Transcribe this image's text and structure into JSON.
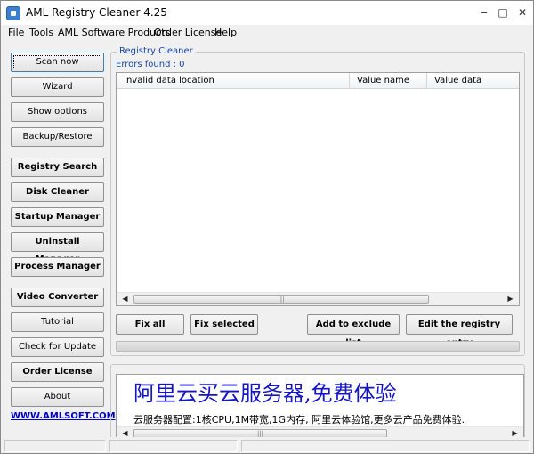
{
  "window": {
    "title": "AML Registry Cleaner 4.25",
    "minimize": "‒",
    "maximize": "□",
    "close": "✕"
  },
  "menu": [
    "File",
    "Tools",
    "AML Software Products",
    "Order License",
    "Help"
  ],
  "sidebar": {
    "scan_now": "Scan now",
    "wizard": "Wizard",
    "show_options": "Show options",
    "backup_restore": "Backup/Restore",
    "registry_search": "Registry Search",
    "disk_cleaner": "Disk Cleaner",
    "startup_manager": "Startup Manager",
    "uninstall_manager": "Uninstall Manager",
    "process_manager": "Process Manager",
    "video_converter": "Video Converter",
    "tutorial": "Tutorial",
    "check_for_update": "Check for Update",
    "order_license": "Order License",
    "about": "About",
    "website": "WWW.AMLSOFT.COM"
  },
  "cleaner": {
    "group_title": "Registry Cleaner",
    "errors_found": "Errors found : 0",
    "columns": [
      "Invalid data location",
      "Value name",
      "Value data"
    ]
  },
  "actions": {
    "fix_all": "Fix all",
    "fix_selected": "Fix selected",
    "add_exclude": "Add to exclude list",
    "edit_entry": "Edit the registry entry"
  },
  "ad": {
    "headline": "阿里云买云服务器,免费体验",
    "body": "云服务器配置:1核CPU,1M带宽,1G内存, 阿里云体验馆,更多云产品免费体验."
  },
  "scroll": {
    "left": "◀",
    "right": "▶",
    "grip": "|||"
  }
}
